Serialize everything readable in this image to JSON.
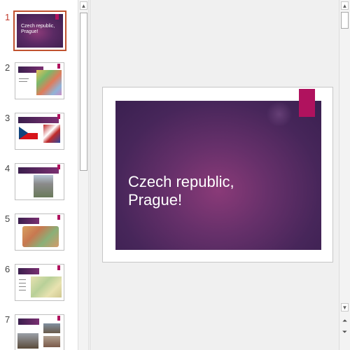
{
  "thumbnails": [
    {
      "number": "1",
      "selected": true,
      "title": "Czech republic, Prague!"
    },
    {
      "number": "2",
      "selected": false
    },
    {
      "number": "3",
      "selected": false
    },
    {
      "number": "4",
      "selected": false
    },
    {
      "number": "5",
      "selected": false
    },
    {
      "number": "6",
      "selected": false
    },
    {
      "number": "7",
      "selected": false
    }
  ],
  "slide": {
    "title": "Czech republic,\nPrague!"
  },
  "icons": {
    "scroll_up": "arrow-up-icon",
    "scroll_down": "arrow-down-icon",
    "previous_slide": "double-chevron-up-icon",
    "next_slide": "double-chevron-down-icon"
  },
  "colors": {
    "accent": "#b0125e",
    "selection_border": "#c0522f",
    "slide_background": "#5a2a64"
  }
}
